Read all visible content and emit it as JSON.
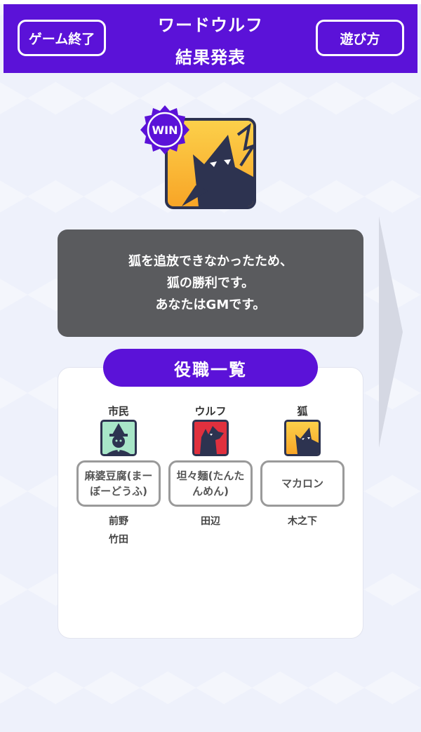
{
  "header": {
    "title": "ワードウルフ",
    "subtitle": "結果発表",
    "end_button": "ゲーム終了",
    "howto_button": "遊び方"
  },
  "hero": {
    "badge": "WIN",
    "icon": "fox-icon"
  },
  "result": {
    "lines": [
      "狐を追放できなかったため、",
      "狐の勝利です。",
      "あなたはGMです。"
    ]
  },
  "roles": {
    "title": "役職一覧",
    "columns": [
      {
        "role": "市民",
        "icon": "villager-icon",
        "word": "麻婆豆腐(まーぼーどうふ)",
        "players": [
          "前野",
          "竹田"
        ]
      },
      {
        "role": "ウルフ",
        "icon": "wolf-icon",
        "word": "坦々麺(たんたんめん)",
        "players": [
          "田辺"
        ]
      },
      {
        "role": "狐",
        "icon": "fox-icon",
        "word": "マカロン",
        "players": [
          "木之下"
        ]
      }
    ]
  },
  "colors": {
    "accent": "#5b12d8",
    "result_bg": "#5a5b5e",
    "fox_yellow": "#fcd04a",
    "wolf_red": "#e0303e",
    "villager_green": "#a8e6c8"
  }
}
